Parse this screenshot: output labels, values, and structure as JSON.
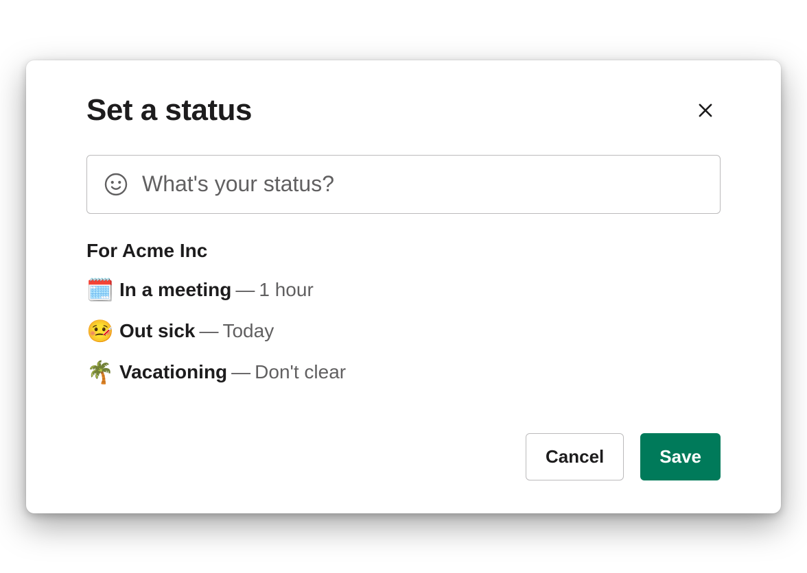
{
  "modal": {
    "title": "Set a status"
  },
  "status_input": {
    "placeholder": "What's your status?",
    "value": ""
  },
  "section": {
    "label": "For Acme Inc"
  },
  "presets": [
    {
      "emoji": "🗓️",
      "label": "In a meeting",
      "separator": "—",
      "duration": "1 hour"
    },
    {
      "emoji": "🤒",
      "label": "Out sick",
      "separator": "—",
      "duration": "Today"
    },
    {
      "emoji": "🌴",
      "label": "Vacationing",
      "separator": "—",
      "duration": "Don't clear"
    }
  ],
  "buttons": {
    "cancel": "Cancel",
    "save": "Save"
  }
}
